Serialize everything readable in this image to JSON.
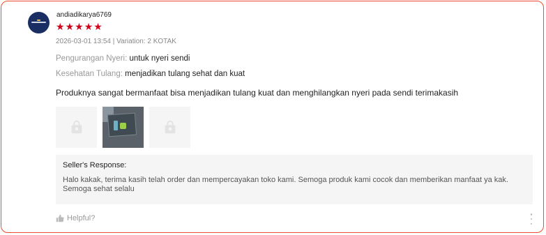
{
  "review": {
    "username": "andiadikarya6769",
    "rating": 5,
    "meta": "2026-03-01 13:54 | Variation: 2 KOTAK",
    "attributes": [
      {
        "key": "Pengurangan Nyeri:",
        "value": "untuk nyeri sendi"
      },
      {
        "key": "Kesehatan Tulang:",
        "value": "menjadikan tulang sehat dan kuat"
      }
    ],
    "comment": "Produknya sangat bermanfaat bisa menjadikan tulang kuat dan menghilangkan nyeri pada sendi terimakasih",
    "media_icons": [
      "placeholder-bag-icon",
      "review-photo",
      "placeholder-bag-icon"
    ]
  },
  "seller_response": {
    "title": "Seller's Response:",
    "body": "Halo kakak, terima kasih telah order dan mempercayakan toko kami. Semoga produk kami cocok dan memberikan manfaat ya kak. Semoga sehat selalu"
  },
  "actions": {
    "helpful_label": "Helpful?",
    "helpful_icon": "thumbs-up-icon",
    "more_icon": "more-vertical-icon"
  },
  "colors": {
    "accent": "#ee4d2d",
    "star": "#d0011b"
  }
}
